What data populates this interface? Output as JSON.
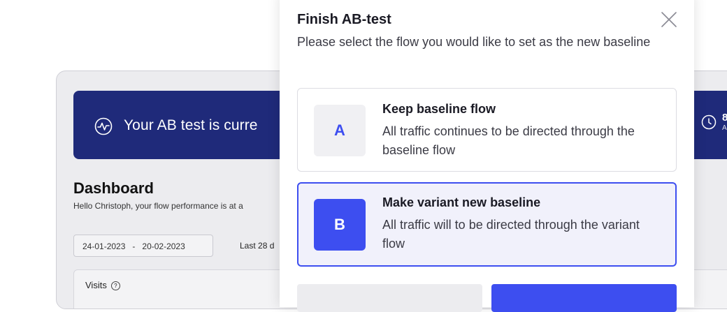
{
  "dashboard": {
    "banner_text": "Your AB test is curre",
    "banner_right_num": "8",
    "banner_right_sub": "A",
    "title": "Dashboard",
    "subtitle": "Hello Christoph, your flow performance is at a",
    "date_from": "24-01-2023",
    "date_sep": "-",
    "date_to": "20-02-2023",
    "range_label": "Last 28 d",
    "visits_label": "Visits",
    "help_glyph": "?"
  },
  "modal": {
    "title": "Finish AB-test",
    "description": "Please select the flow you would like to set as the new baseline",
    "options": [
      {
        "badge": "A",
        "title": "Keep baseline flow",
        "description": "All traffic continues to be directed through the baseline flow",
        "selected": false
      },
      {
        "badge": "B",
        "title": "Make variant new baseline",
        "description": "All traffic will to be directed through the variant flow",
        "selected": true
      }
    ]
  },
  "icons": {
    "banner": "activity-pulse-icon",
    "clock": "clock-icon",
    "close": "close-icon",
    "help": "help-circle-icon"
  },
  "colors": {
    "accent": "#3d4ef0",
    "banner_bg": "#1f2a7a",
    "selected_bg": "#f1f1fb"
  }
}
